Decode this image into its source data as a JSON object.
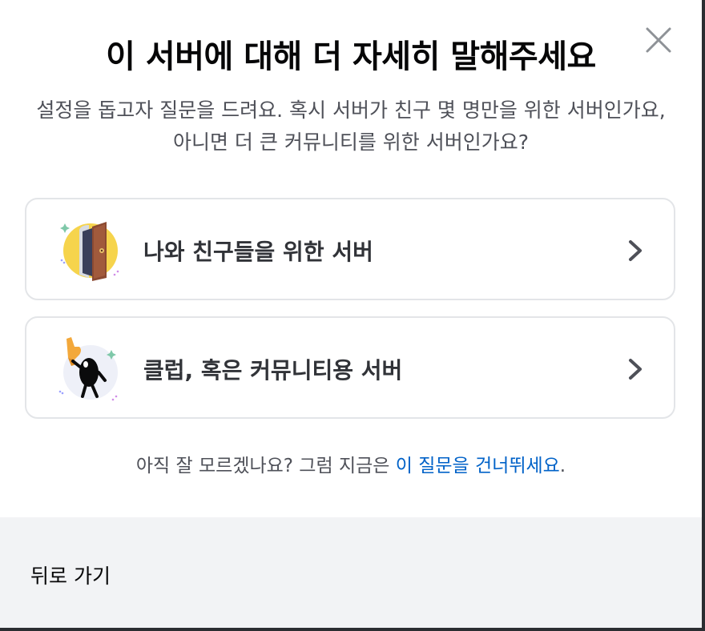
{
  "modal": {
    "title": "이 서버에 대해 더 자세히 말해주세요",
    "subtitle": "설정을 돕고자 질문을 드려요. 혹시 서버가 친구 몇 명만을 위한 서버인가요, 아니면 더 큰 커뮤니티를 위한 서버인가요?"
  },
  "options": [
    {
      "label": "나와 친구들을 위한 서버",
      "icon": "door-illustration-icon"
    },
    {
      "label": "클럽, 혹은 커뮤니티용 서버",
      "icon": "foam-finger-mascot-icon"
    }
  ],
  "skip": {
    "prefix": "아직 잘 모르겠나요? 그럼 지금은 ",
    "link": "이 질문을 건너뛰세요",
    "suffix": "."
  },
  "footer": {
    "back_label": "뒤로 가기"
  },
  "colors": {
    "title": "#060607",
    "subtitle": "#4e5058",
    "link": "#0062c8",
    "footer_bg": "#f2f3f5",
    "card_border": "#e3e5e8"
  }
}
